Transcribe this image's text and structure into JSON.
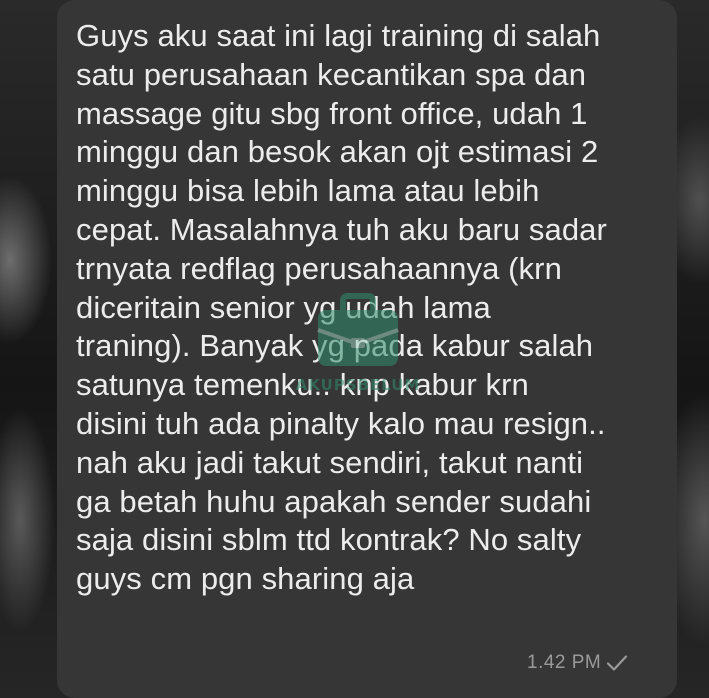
{
  "chat": {
    "message": {
      "lines": [
        "Guys aku saat ini lagi training di salah",
        "satu perusahaan kecantikan spa dan",
        "massage gitu sbg front office, udah 1",
        "minggu dan besok akan ojt estimasi 2",
        "minggu bisa lebih lama atau lebih",
        "cepat. Masalahnya tuh aku baru sadar",
        "trnyata redflag perusahaannya (krn",
        "diceritain senior yg udah lama",
        "traning). Banyak yg pada kabur salah",
        "satunya temenku..  knp kabur krn",
        "disini tuh ada pinalty kalo mau resign..",
        "nah aku jadi takut sendiri, takut nanti",
        "ga betah huhu apakah sender sudahi",
        "saja disini sblm ttd kontrak? No salty",
        "guys cm pgn sharing aja"
      ],
      "time": "1.42 PM",
      "status_icon": "check-icon"
    },
    "watermark": {
      "text": "AKUPSBELUM",
      "icon": "briefcase-icon"
    },
    "colors": {
      "bubble": "#363636",
      "text": "#ececec",
      "meta": "#9a9a9a",
      "watermark": "#2f8c6b"
    }
  }
}
